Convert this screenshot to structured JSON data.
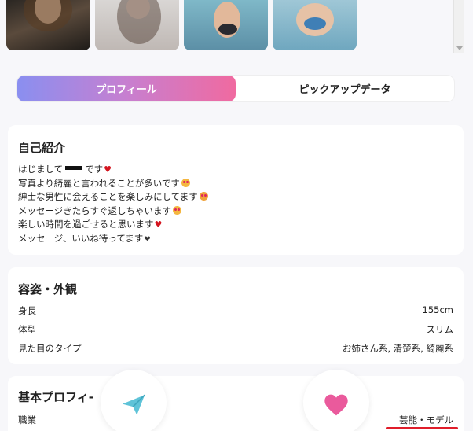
{
  "tabs": {
    "profile": "プロフィール",
    "pickup": "ピックアップデータ"
  },
  "intro": {
    "title": "自己紹介",
    "line1_a": "はじまして",
    "line1_b": "です",
    "line2": "写真より綺麗と言われることが多いです",
    "line3": "紳士な男性に会えることを楽しみにしてます",
    "line4": "メッセージきたらすぐ返しちゃいます",
    "line5": "楽しい時間を過ごせると思います",
    "line6": "メッセージ、いいね待ってます"
  },
  "appearance": {
    "title": "容姿・外観",
    "rows": [
      {
        "label": "身長",
        "value": "155cm"
      },
      {
        "label": "体型",
        "value": "スリム"
      },
      {
        "label": "見た目のタイプ",
        "value": "お姉さん系, 清楚系, 綺麗系"
      }
    ]
  },
  "basic": {
    "title": "基本プロフィ-",
    "rows": [
      {
        "label": "職業",
        "value": "芸能・モデル"
      }
    ]
  },
  "colors": {
    "accent_gradient": [
      "#8a8ff0",
      "#f06aa0"
    ],
    "send_icon": "#5ec3d8",
    "like_icon": "#ea5a9c",
    "highlight": "#e01d2a"
  },
  "icons": [
    "send-icon",
    "heart-icon",
    "scroll-down-arrow-icon"
  ]
}
